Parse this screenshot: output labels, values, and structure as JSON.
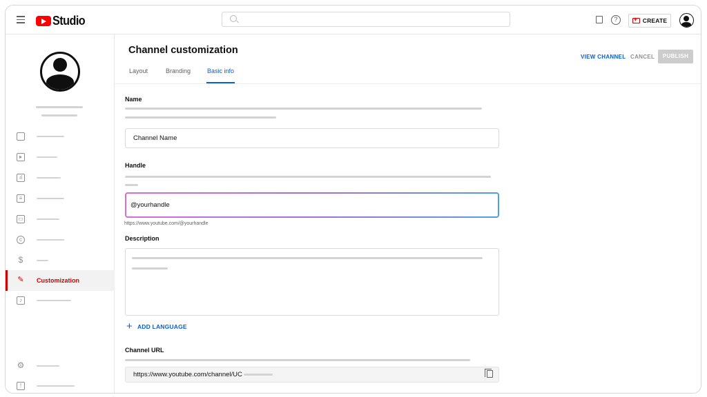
{
  "header": {
    "app_name": "Studio",
    "create_label": "CREATE"
  },
  "sidebar": {
    "active_item": "Customization"
  },
  "page": {
    "title": "Channel customization",
    "tabs": [
      {
        "label": "Layout",
        "active": false
      },
      {
        "label": "Branding",
        "active": false
      },
      {
        "label": "Basic info",
        "active": true
      }
    ],
    "actions": {
      "view_channel": "VIEW CHANNEL",
      "cancel": "CANCEL",
      "publish": "PUBLISH"
    }
  },
  "form": {
    "name": {
      "label": "Name",
      "value": "Channel Name"
    },
    "handle": {
      "label": "Handle",
      "value": "@yourhandle",
      "helper": "https://www.youtube.com/@yourhandle"
    },
    "description": {
      "label": "Description",
      "value": ""
    },
    "add_language": "ADD LANGUAGE",
    "channel_url": {
      "label": "Channel URL",
      "value": "https://www.youtube.com/channel/UC"
    }
  },
  "colors": {
    "accent_blue": "#065fd4",
    "active_red": "#cc0000",
    "handle_gradient_start": "#d66dd6",
    "handle_gradient_end": "#4f9fe0"
  },
  "icons": [
    "menu-icon",
    "youtube-logo-icon",
    "search-icon",
    "comment-icon",
    "help-icon",
    "create-video-icon",
    "account-avatar-icon",
    "dashboard-icon",
    "content-icon",
    "analytics-icon",
    "comments-icon",
    "subtitles-icon",
    "copyright-icon",
    "earn-icon",
    "customization-icon",
    "audio-library-icon",
    "settings-icon",
    "feedback-icon",
    "plus-icon",
    "copy-icon"
  ]
}
